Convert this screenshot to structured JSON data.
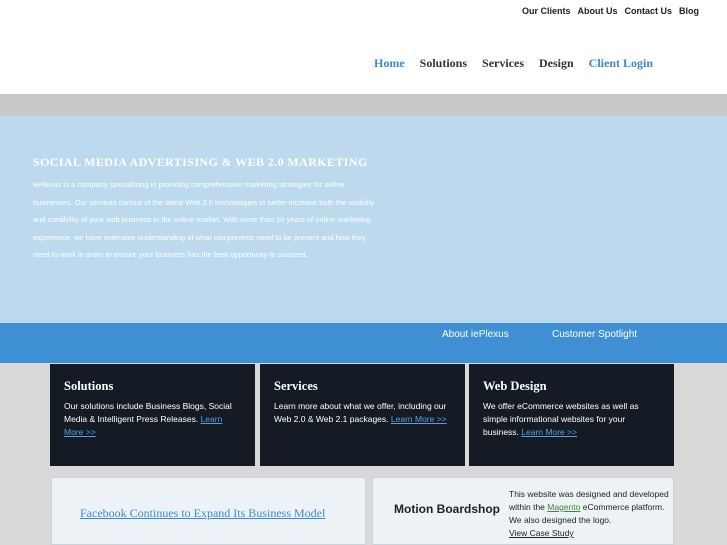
{
  "top_links": [
    "Our Clients",
    "About Us",
    "Contact Us",
    "Blog"
  ],
  "nav": {
    "home": "Home",
    "solutions": "Solutions",
    "services": "Services",
    "design": "Design",
    "client_login": "Client Login"
  },
  "hero": {
    "title": "SOCIAL MEDIA ADVERTISING & WEB 2.0 MARKETING",
    "body": "iePlexus is a company specializing in providing comprehensive marketing strategies for online businesses. Our services consist of the latest Web 2.0 technologies to better increase both the visibility and credibility of your web business in the online market. With more than 10 years of online marketing experience, we have extensive understanding of what components need to be present and how they need to work in order to ensure your business has the best opportunity to succeed."
  },
  "blue_bar": {
    "about": "About iePlexus",
    "spotlight": "Customer Spotlight"
  },
  "cards": [
    {
      "title": "Solutions",
      "text": "Our solutions include Business Blogs, Social Media & Intelligent Press Releases.",
      "link": "Learn More >>"
    },
    {
      "title": "Services",
      "text": "Learn more about what we offer, including our Web 2.0 & Web 2.1 packages.",
      "link": "Learn More >>"
    },
    {
      "title": "Web Design",
      "text": "We offer eCommerce websites as well as simple informational websites for your business.",
      "link": "Learn More >>"
    }
  ],
  "news": {
    "headline": "Facebook Continues to Expand Its Business Model"
  },
  "showcase": {
    "title": "Motion Boardshop",
    "text_before": "This website was designed and developed within the",
    "link": "Magento",
    "text_after": "eCommerce platform. We also designed the logo.",
    "case_study": "View Case Study"
  },
  "colors": {
    "accent": "#3a8ad0",
    "hero_bg": "#bcd9ee",
    "bar_bg": "#3f8fd4",
    "card_bg": "#151b24"
  }
}
